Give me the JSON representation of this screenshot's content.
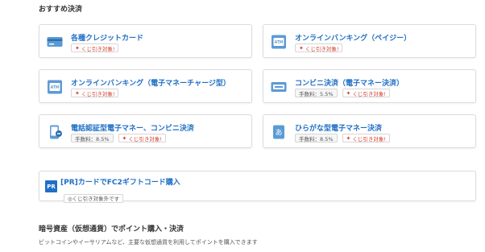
{
  "recommended": {
    "title": "おすすめ決済",
    "cards": [
      {
        "title": "各種クレジットカード",
        "icon": "credit-card-icon",
        "fee": null,
        "lottery": "くじ引き対象!"
      },
      {
        "title": "オンラインバンキング（ペイジー）",
        "icon": "atm-icon",
        "fee": null,
        "lottery": "くじ引き対象!"
      },
      {
        "title": "オンラインバンキング（電子マネーチャージ型）",
        "icon": "atm-icon",
        "fee": null,
        "lottery": "くじ引き対象!"
      },
      {
        "title": "コンビニ決済（電子マネー決済）",
        "icon": "convenience-store-icon",
        "fee": "手数料：5.5%",
        "lottery": "くじ引き対象!"
      },
      {
        "title": "電話認証型電子マネー、コンビニ決済",
        "icon": "phone-icon",
        "fee": "手数料：8.5%",
        "lottery": "くじ引き対象!"
      },
      {
        "title": "ひらがな型電子マネー決済",
        "icon": "hiragana-icon",
        "fee": "手数料：8.5%",
        "lottery": "くじ引き対象!"
      }
    ]
  },
  "pr": {
    "badge": "PR",
    "title": "[PR]カードでFC2ギフトコード購入",
    "tag": "◎くじ引き対象外です"
  },
  "crypto": {
    "title": "暗号資産（仮想通貨）でポイント購入・決済",
    "description": "ビットコインやイーサリアムなど、主要な仮想通貨を利用してポイントを購入できます"
  },
  "icons": {
    "atm_label": "ATM",
    "hiragana_glyph": "あ"
  },
  "colors": {
    "accent": "#1f6fc5",
    "lottery": "#d23c28"
  }
}
